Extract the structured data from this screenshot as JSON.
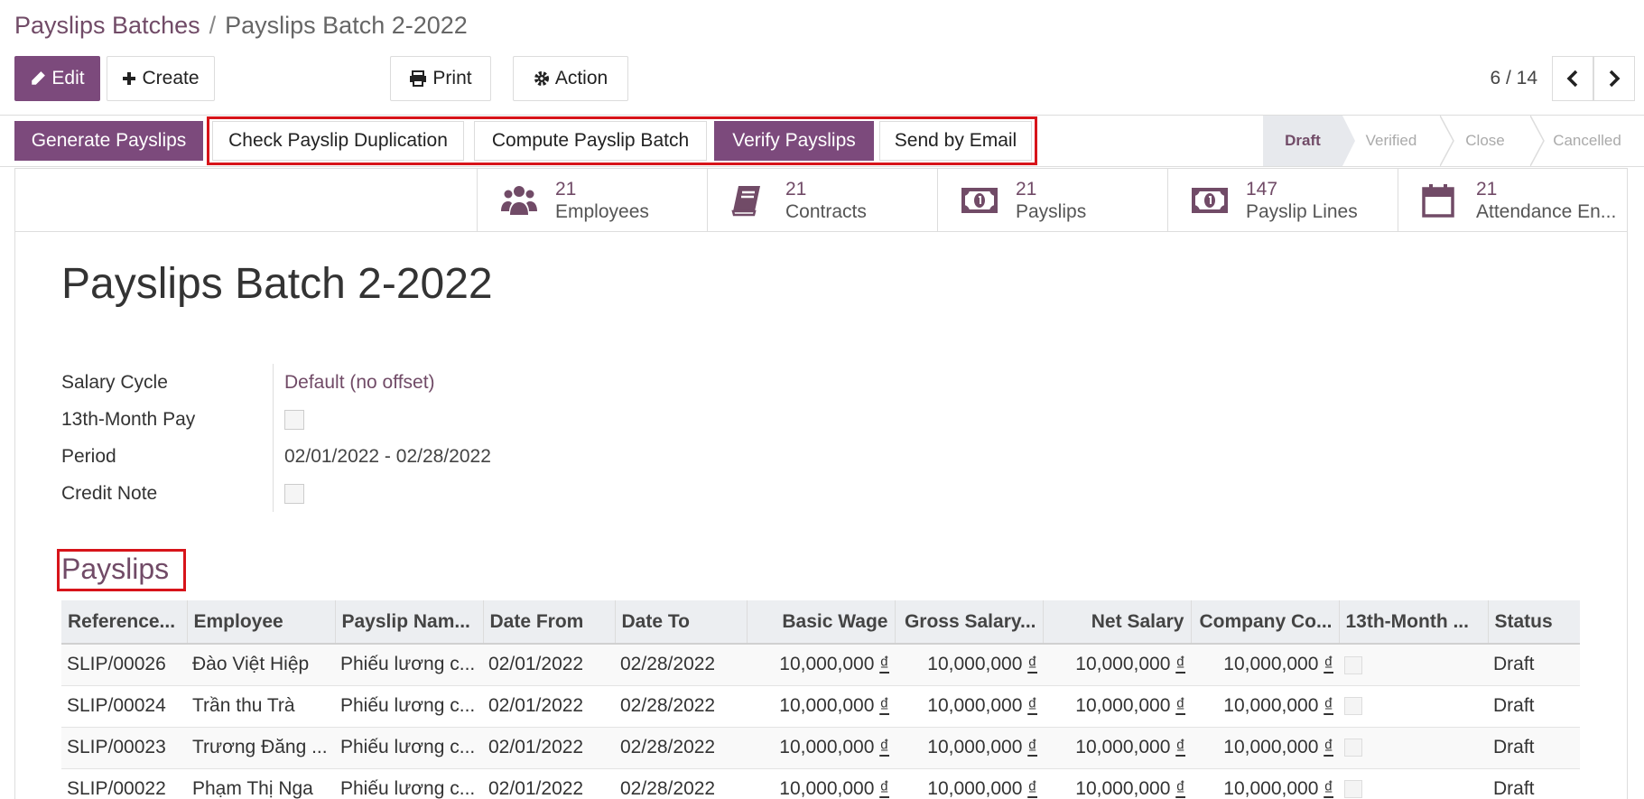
{
  "breadcrumb": {
    "parent": "Payslips Batches",
    "separator": "/",
    "current": "Payslips Batch 2-2022"
  },
  "toolbar": {
    "edit": "Edit",
    "create": "Create",
    "print": "Print",
    "action": "Action"
  },
  "pager": {
    "text": "6 / 14"
  },
  "header_buttons": {
    "generate": "Generate Payslips",
    "check_duplication": "Check Payslip Duplication",
    "compute": "Compute Payslip Batch",
    "verify": "Verify Payslips",
    "send_email": "Send by Email"
  },
  "stages": [
    "Draft",
    "Verified",
    "Close",
    "Cancelled"
  ],
  "active_stage": "Draft",
  "smart_buttons": [
    {
      "count": "21",
      "label": "Employees",
      "icon": "users-icon"
    },
    {
      "count": "21",
      "label": "Contracts",
      "icon": "book-icon"
    },
    {
      "count": "21",
      "label": "Payslips",
      "icon": "money-icon"
    },
    {
      "count": "147",
      "label": "Payslip Lines",
      "icon": "money-icon"
    },
    {
      "count": "21",
      "label": "Attendance En...",
      "icon": "calendar-icon"
    }
  ],
  "record": {
    "title": "Payslips Batch 2-2022",
    "fields": {
      "salary_cycle_label": "Salary Cycle",
      "salary_cycle_value": "Default (no offset)",
      "thirteenth_label": "13th-Month Pay",
      "period_label": "Period",
      "period_value": "02/01/2022 - 02/28/2022",
      "credit_note_label": "Credit Note"
    }
  },
  "payslips": {
    "section_title": "Payslips",
    "columns": [
      "Reference...",
      "Employee",
      "Payslip Nam...",
      "Date From",
      "Date To",
      "Basic Wage",
      "Gross Salary...",
      "Net Salary",
      "Company Co...",
      "13th-Month ...",
      "Status"
    ],
    "rows": [
      [
        "SLIP/00026",
        "Đào Việt Hiệp",
        "Phiếu lương c...",
        "02/01/2022",
        "02/28/2022",
        "10,000,000",
        "10,000,000",
        "10,000,000",
        "10,000,000",
        "",
        "Draft"
      ],
      [
        "SLIP/00024",
        "Trần thu Trà",
        "Phiếu lương c...",
        "02/01/2022",
        "02/28/2022",
        "10,000,000",
        "10,000,000",
        "10,000,000",
        "10,000,000",
        "",
        "Draft"
      ],
      [
        "SLIP/00023",
        "Trương Đăng ...",
        "Phiếu lương c...",
        "02/01/2022",
        "02/28/2022",
        "10,000,000",
        "10,000,000",
        "10,000,000",
        "10,000,000",
        "",
        "Draft"
      ],
      [
        "SLIP/00022",
        "Phạm Thị Nga",
        "Phiếu lương c...",
        "02/01/2022",
        "02/28/2022",
        "10,000,000",
        "10,000,000",
        "10,000,000",
        "10,000,000",
        "",
        "Draft"
      ]
    ],
    "currency_symbol": "₫"
  },
  "colors": {
    "brand": "#714b67",
    "highlight": "#d7141a"
  }
}
